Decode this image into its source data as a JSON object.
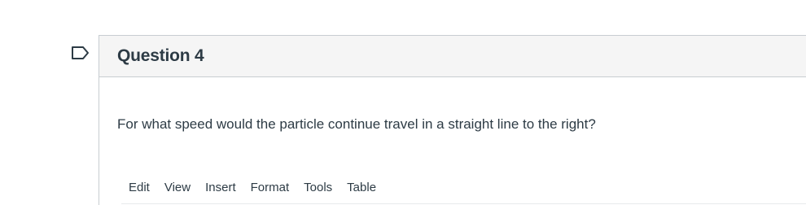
{
  "question": {
    "title": "Question 4",
    "text": "For what speed would the particle continue travel in a straight line to the right?"
  },
  "editor": {
    "menu": [
      {
        "label": "Edit"
      },
      {
        "label": "View"
      },
      {
        "label": "Insert"
      },
      {
        "label": "Format"
      },
      {
        "label": "Tools"
      },
      {
        "label": "Table"
      }
    ]
  },
  "colors": {
    "text": "#2d3b45",
    "header_bg": "#f5f5f5",
    "border": "#c7cdd1",
    "flag_stroke": "#2d3b45"
  },
  "icons": {
    "flag": "flag-question-icon"
  }
}
